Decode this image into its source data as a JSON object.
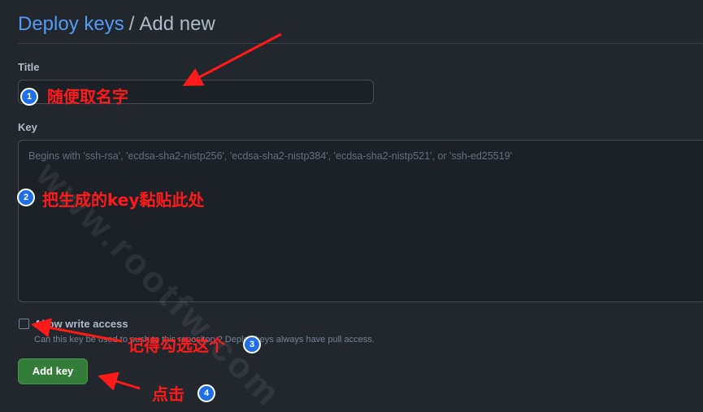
{
  "breadcrumb": {
    "parent": "Deploy keys",
    "separator": "/",
    "current": "Add new"
  },
  "form": {
    "title_label": "Title",
    "title_value": "",
    "key_label": "Key",
    "key_placeholder": "Begins with 'ssh-rsa', 'ecdsa-sha2-nistp256', 'ecdsa-sha2-nistp384', 'ecdsa-sha2-nistp521', or 'ssh-ed25519'",
    "allow_write_label": "Allow write access",
    "allow_write_checked": false,
    "allow_write_note": "Can this key be used to push to this repository? Deploy keys always have pull access.",
    "submit_label": "Add key"
  },
  "annotations": {
    "step1_badge": "1",
    "step1_text": "随便取名字",
    "step2_badge": "2",
    "step2_text": "把生成的key黏贴此处",
    "step3_badge": "3",
    "step3_text": "记得勾选这个",
    "step4_badge": "4",
    "step4_text": "点击",
    "watermark": "www.rootfw.com",
    "color": "#ff1a1a"
  }
}
